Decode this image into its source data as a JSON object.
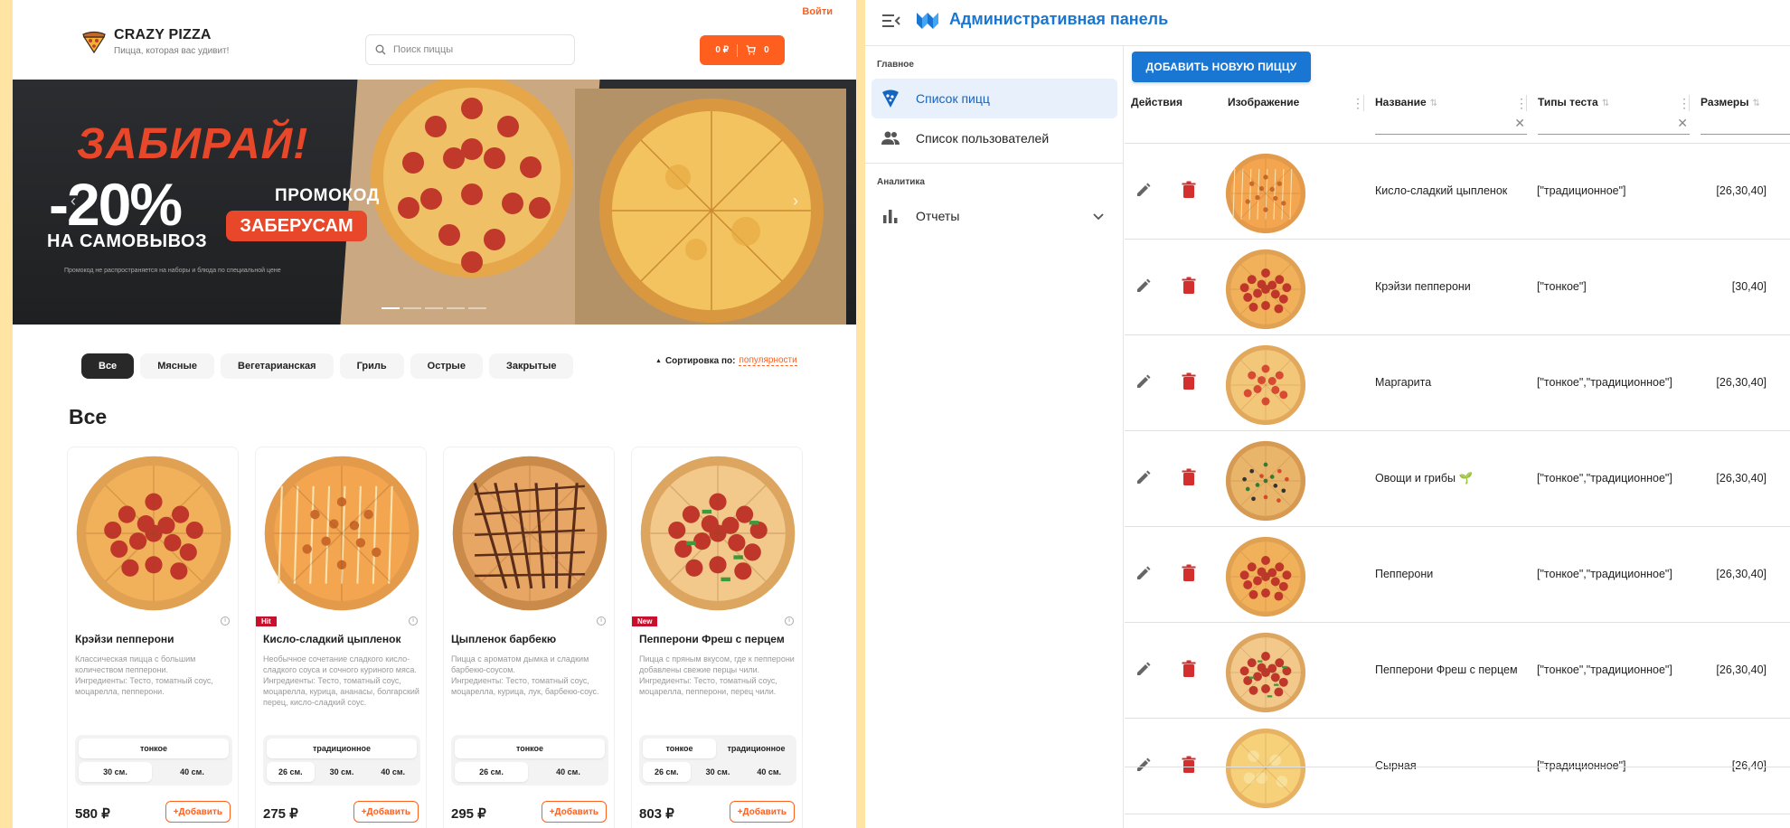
{
  "shop": {
    "login": "Войти",
    "brand": "CRAZY PIZZA",
    "tagline": "Пицца, которая вас удивит!",
    "search_placeholder": "Поиск пиццы",
    "cart": {
      "total": "0 ₽",
      "count": "0"
    },
    "banner": {
      "headline": "ЗАБИРАЙ!",
      "discount": "-20%",
      "pickup": "НА САМОВЫВОЗ",
      "promo_label": "ПРОМОКОД",
      "promo_code": "ЗАБЕРУСАМ",
      "fine_print": "Промокод не распространяется на наборы и блюда по специальной цене",
      "slides": 5,
      "active_slide": 1
    },
    "categories": [
      "Все",
      "Мясные",
      "Вегетарианская",
      "Гриль",
      "Острые",
      "Закрытые"
    ],
    "active_category": 0,
    "sort": {
      "label": "Сортировка по:",
      "value": "популярности"
    },
    "section_title": "Все",
    "products": [
      {
        "name": "Крэйзи пепперони",
        "badge": "",
        "desc": "Классическая пицца с большим количеством пепперони.",
        "ingredients": "Ингредиенты: Тесто, томатный соус, моцарелла, пепперони.",
        "doughs": [
          "тонкое"
        ],
        "sizes": [
          "30 см.",
          "40 см."
        ],
        "price": "580 ₽",
        "add": "+Добавить",
        "topping": "pepperoni"
      },
      {
        "name": "Кисло-сладкий цыпленок",
        "badge": "Hit",
        "desc": "Необычное сочетание сладкого кисло-сладкого соуса и сочного куриного мяса.",
        "ingredients": "Ингредиенты: Тесто, томатный соус, моцарелла, курица, ананасы, болгарский перец, кисло-сладкий соус.",
        "doughs": [
          "традиционное"
        ],
        "sizes": [
          "26 см.",
          "30 см.",
          "40 см."
        ],
        "price": "275 ₽",
        "add": "+Добавить",
        "topping": "sweet"
      },
      {
        "name": "Цыпленок барбекю",
        "badge": "",
        "desc": "Пицца с ароматом дымка и сладким барбекю-соусом.",
        "ingredients": "Ингредиенты: Тесто, томатный соус, моцарелла, курица, лук, барбекю-соус.",
        "doughs": [
          "тонкое"
        ],
        "sizes": [
          "26 см.",
          "40 см."
        ],
        "price": "295 ₽",
        "add": "+Добавить",
        "topping": "bbq"
      },
      {
        "name": "Пепперони Фреш с перцем",
        "badge": "New",
        "desc": "Пицца с пряным вкусом, где к пепперони добавлены свежие перцы чили.",
        "ingredients": "Ингредиенты: Тесто, томатный соус, моцарелла, пепперони, перец чили.",
        "doughs": [
          "тонкое",
          "традиционное"
        ],
        "sizes": [
          "26 см.",
          "30 см.",
          "40 см."
        ],
        "price": "803 ₽",
        "add": "+Добавить",
        "topping": "fresh"
      }
    ]
  },
  "admin": {
    "title": "Административная панель",
    "nav": {
      "main_heading": "Главное",
      "pizzas": "Список пицц",
      "users": "Список пользователей",
      "analytics_heading": "Аналитика",
      "reports": "Отчеты"
    },
    "add_button": "ДОБАВИТЬ НОВУЮ ПИЦЦУ",
    "columns": {
      "actions": "Действия",
      "image": "Изображение",
      "name": "Название",
      "types": "Типы теста",
      "sizes": "Размеры"
    },
    "rows": [
      {
        "name": "Кисло-сладкий цыпленок",
        "types": "[\"традиционное\"]",
        "sizes": "[26,30,40]",
        "topping": "sweet"
      },
      {
        "name": "Крэйзи пепперони",
        "types": "[\"тонкое\"]",
        "sizes": "[30,40]",
        "topping": "pepperoni"
      },
      {
        "name": "Маргарита",
        "types": "[\"тонкое\",\"традиционное\"]",
        "sizes": "[26,30,40]",
        "topping": "margherita"
      },
      {
        "name": "Овощи и грибы 🌱",
        "types": "[\"тонкое\",\"традиционное\"]",
        "sizes": "[26,30,40]",
        "topping": "veg"
      },
      {
        "name": "Пепперони",
        "types": "[\"тонкое\",\"традиционное\"]",
        "sizes": "[26,30,40]",
        "topping": "pepperoni"
      },
      {
        "name": "Пепперони Фреш с перцем",
        "types": "[\"тонкое\",\"традиционное\"]",
        "sizes": "[26,30,40]",
        "topping": "fresh"
      },
      {
        "name": "Сырная",
        "types": "[\"традиционное\"]",
        "sizes": "[26,40]",
        "topping": "cheese"
      }
    ]
  },
  "colors": {
    "brand_orange": "#fe5f1e",
    "admin_blue": "#1976d2",
    "delete_red": "#d32f2f"
  }
}
